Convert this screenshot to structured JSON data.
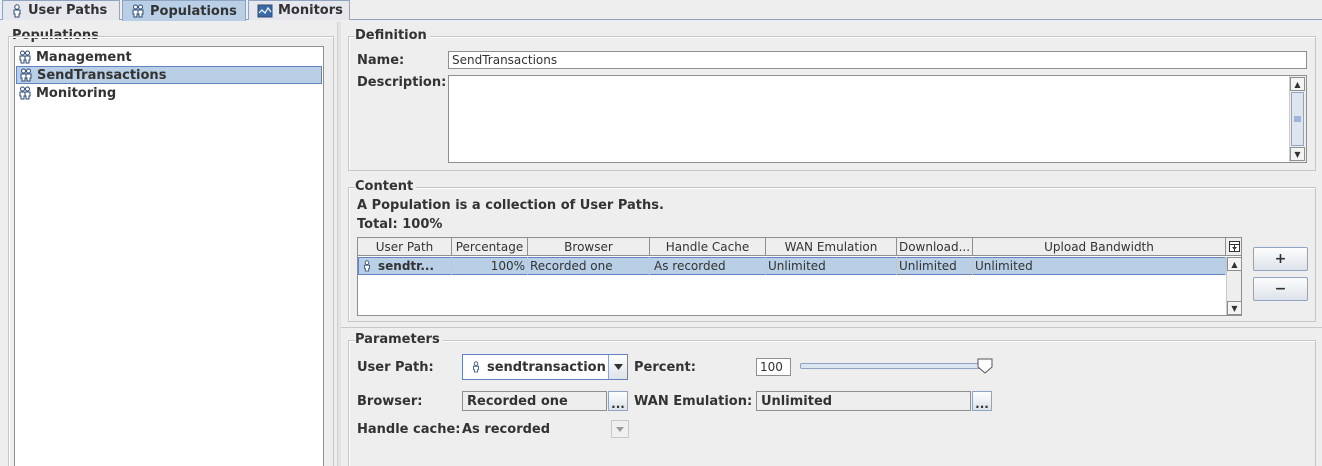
{
  "tabs": [
    {
      "label": "User Paths",
      "icon": "user-icon"
    },
    {
      "label": "Populations",
      "icon": "population-icon"
    },
    {
      "label": "Monitors",
      "icon": "monitor-icon"
    }
  ],
  "populations_panel": {
    "title": "Populations",
    "items": [
      "Management",
      "SendTransactions",
      "Monitoring"
    ],
    "selected_index": 1
  },
  "definition": {
    "title": "Definition",
    "name_label": "Name:",
    "name_value": "SendTransactions",
    "description_label": "Description:",
    "description_value": ""
  },
  "content": {
    "title": "Content",
    "subtitle": "A Population is a collection of User Paths.",
    "total": "Total: 100%",
    "columns": [
      "User Path",
      "Percentage",
      "Browser",
      "Handle Cache",
      "WAN Emulation",
      "Download...",
      "Upload Bandwidth"
    ],
    "rows": [
      [
        "sendtr...",
        "100%",
        "Recorded one",
        "As recorded",
        "Unlimited",
        "Unlimited",
        "Unlimited"
      ]
    ],
    "add_label": "+",
    "remove_label": "−"
  },
  "parameters": {
    "title": "Parameters",
    "user_path_label": "User Path:",
    "user_path_value": "sendtransaction",
    "percent_label": "Percent:",
    "percent_value": "100",
    "percent_slider": 100,
    "browser_label": "Browser:",
    "browser_value": "Recorded one",
    "browser_btn": "...",
    "wan_label": "WAN Emulation:",
    "wan_value": "Unlimited",
    "wan_btn": "...",
    "handle_cache_label": "Handle cache:",
    "handle_cache_value": "As recorded"
  },
  "colors": {
    "selection": "#b8cfe5",
    "selection_border": "#6382bf",
    "background": "#eeeeee"
  }
}
